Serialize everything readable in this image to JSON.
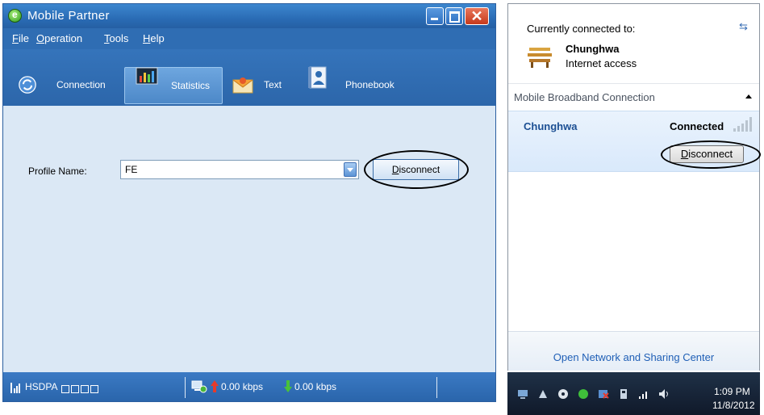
{
  "left_window": {
    "title": "Mobile Partner",
    "menu": [
      {
        "first": "F",
        "rest": "ile"
      },
      {
        "first": "O",
        "rest": "peration"
      },
      {
        "first": "T",
        "rest": "ools"
      },
      {
        "first": "H",
        "rest": "elp"
      }
    ],
    "tabs": [
      "Connection",
      "Statistics",
      "Text",
      "Phonebook"
    ],
    "active_tab": "Statistics",
    "profile_label": "Profile Name:",
    "profile_value": "FE",
    "disconnect_first": "D",
    "disconnect_rest": "isconnect",
    "status": {
      "network_mode": "HSDPA",
      "upload_rate": "0.00 kbps",
      "download_rate": "0.00 kbps"
    }
  },
  "right_flyout": {
    "currently_connected_label": "Currently connected to:",
    "network_name": "Chunghwa",
    "network_access": "Internet access",
    "section_title": "Mobile Broadband Connection",
    "connection_name": "Chunghwa",
    "connection_status": "Connected",
    "disconnect_first": "D",
    "disconnect_rest": "isconnect",
    "footer_link": "Open Network and Sharing Center"
  },
  "taskbar": {
    "time": "1:09 PM",
    "date": "11/8/2012"
  },
  "colors": {
    "window_blue": "#2f6db3",
    "body_blue": "#dbe8f5",
    "flyout_highlight": "#d9e9fb",
    "link_blue": "#1f5fb6"
  }
}
